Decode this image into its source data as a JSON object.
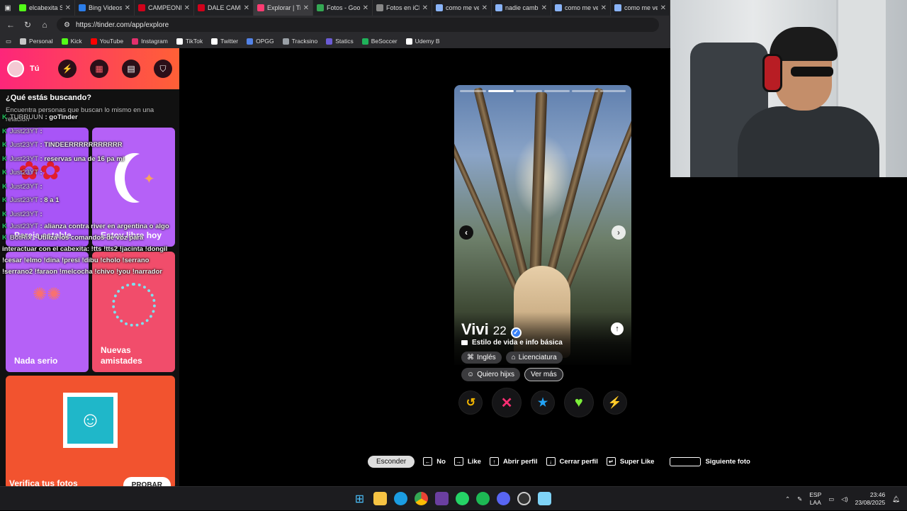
{
  "browser": {
    "tabs": [
      {
        "label": "elcabexita S",
        "color": "#53fc18",
        "active": false
      },
      {
        "label": "Bing Videos",
        "color": "#2b7de9",
        "active": false
      },
      {
        "label": "CAMPEONES",
        "color": "#d0021b",
        "active": false
      },
      {
        "label": "DALE CAMP",
        "color": "#d0021b",
        "active": false
      },
      {
        "label": "Explorar | Ti",
        "color": "#fe3c72",
        "active": true
      },
      {
        "label": "Fotos - Goo",
        "color": "#34a853",
        "active": false
      },
      {
        "label": "Fotos en iCl",
        "color": "#888888",
        "active": false
      },
      {
        "label": "como me ve",
        "color": "#8ab4f8",
        "active": false
      },
      {
        "label": "nadie camb",
        "color": "#8ab4f8",
        "active": false
      },
      {
        "label": "como me ve",
        "color": "#8ab4f8",
        "active": false
      },
      {
        "label": "como me ve",
        "color": "#8ab4f8",
        "active": false
      }
    ],
    "url": "https://tinder.com/app/explore",
    "bookmarks": [
      {
        "label": "Personal",
        "color": "#c6c6c6"
      },
      {
        "label": "Kick",
        "color": "#53fc18"
      },
      {
        "label": "YouTube",
        "color": "#ff0000"
      },
      {
        "label": "Instagram",
        "color": "#e1306c"
      },
      {
        "label": "TikTok",
        "color": "#ffffff"
      },
      {
        "label": "Twitter",
        "color": "#ffffff"
      },
      {
        "label": "OPGG",
        "color": "#5383e8"
      },
      {
        "label": "Tracksino",
        "color": "#9aa0a6"
      },
      {
        "label": "Statics",
        "color": "#6b5bd6"
      },
      {
        "label": "BeSoccer",
        "color": "#1fb25a"
      },
      {
        "label": "Udemy B",
        "color": "#ffffff"
      }
    ]
  },
  "sidebar": {
    "user": "Tú",
    "question": "¿Qué estás buscando?",
    "subtitle": "Encuentra personas que buscan lo mismo en una relación",
    "cards": [
      {
        "label": "Pareja estable"
      },
      {
        "label": "Estoy libre hoy"
      },
      {
        "label": "Nada serio"
      },
      {
        "label": "Nuevas amistades"
      },
      {
        "label": "Verifica tus fotos",
        "button": "PROBAR"
      }
    ]
  },
  "chat": [
    {
      "user": "TURRUUN",
      "msg": ": goTinder"
    },
    {
      "user": "Just23YT",
      "msg": ":"
    },
    {
      "user": "Just23YT",
      "msg": ": TINDEERRRRRRRRRRR"
    },
    {
      "user": "Just23YT",
      "msg": ": reservas una de 16 pa mi"
    },
    {
      "user": "Just23YT",
      "msg": ":"
    },
    {
      "user": "Just23YT",
      "msg": ":"
    },
    {
      "user": "Just23YT",
      "msg": ": 8 a 1"
    },
    {
      "user": "Just23YT",
      "msg": ":"
    },
    {
      "user": "Just23YT",
      "msg": ": alianza contra river en argentina o algo"
    },
    {
      "user": "BotRix",
      "msg": ": Utiliza los comandos de voz para interactuar con el cabexita: !tts !tts2 !jacinta !dongil !cesar !elmo !dina !presi !dibu !cholo !serrano !serrano2 !faraon !melcocha !chivo !you !narrador"
    }
  ],
  "profile": {
    "name": "Vivi",
    "age": "22",
    "photos_total": 6,
    "photo_current": 2,
    "basic_info": "Estilo de vida e info básica",
    "chips_row1": [
      "Inglés",
      "Licenciatura"
    ],
    "chips_row2": [
      "Quiero hijxs",
      "Ver más"
    ]
  },
  "actions": [
    {
      "name": "rewind",
      "glyph": "↺",
      "color": "#f5b700"
    },
    {
      "name": "nope",
      "glyph": "✕",
      "color": "#fd2e73"
    },
    {
      "name": "super-like",
      "glyph": "★",
      "color": "#22a3f5"
    },
    {
      "name": "like",
      "glyph": "♥",
      "color": "#7cf03a"
    },
    {
      "name": "boost",
      "glyph": "⚡",
      "color": "#b55df7"
    }
  ],
  "shortcuts": {
    "hide": "Esconder",
    "items": [
      {
        "key": "←",
        "label": "No"
      },
      {
        "key": "→",
        "label": "Like"
      },
      {
        "key": "↑",
        "label": "Abrir perfil"
      },
      {
        "key": "↓",
        "label": "Cerrar perfil"
      },
      {
        "key": "↵",
        "label": "Super Like"
      },
      {
        "key": "",
        "label": "Siguiente foto"
      }
    ]
  },
  "taskbar": {
    "lang_top": "ESP",
    "lang_bottom": "LAA",
    "time": "23:46",
    "date": "23/08/2025"
  }
}
